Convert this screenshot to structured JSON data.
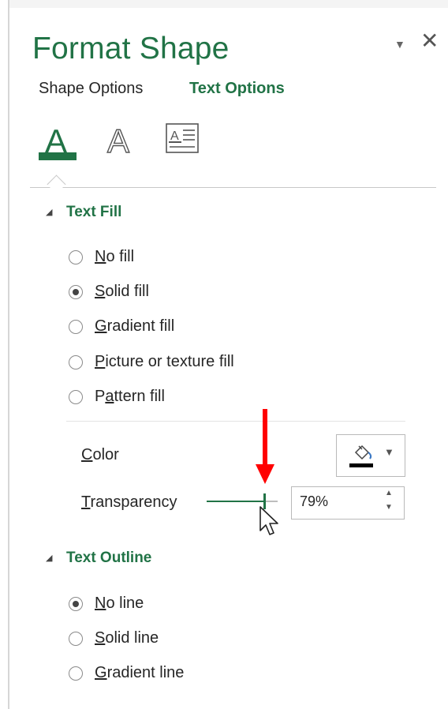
{
  "pane": {
    "title": "Format Shape",
    "options_icon": "triangle-down-icon",
    "close_icon": "close-icon",
    "options_glyph": "▼",
    "close_glyph": "✕"
  },
  "tabs": [
    {
      "label": "Shape Options",
      "active": false
    },
    {
      "label": "Text Options",
      "active": true
    }
  ],
  "category_icons": [
    {
      "name": "text-fill-outline-icon",
      "glyph": "A",
      "selected": true
    },
    {
      "name": "text-effects-icon",
      "glyph": "A",
      "selected": false
    },
    {
      "name": "textbox-icon",
      "selected": false
    }
  ],
  "accent_color": "#217346",
  "text_fill": {
    "heading": "Text Fill",
    "options": [
      {
        "accel": "N",
        "rest": "o fill",
        "selected": false
      },
      {
        "accel": "S",
        "rest": "olid fill",
        "selected": true
      },
      {
        "accel": "G",
        "rest": "radient fill",
        "selected": false
      },
      {
        "accel": "P",
        "rest": "icture or texture fill",
        "selected": false
      },
      {
        "pre": "P",
        "accel": "a",
        "rest": "ttern fill",
        "selected": false
      }
    ],
    "color": {
      "label_accel": "C",
      "label_rest": "olor",
      "icon": "paint-bucket-icon",
      "current_color": "#000000"
    },
    "transparency": {
      "label_accel": "T",
      "label_rest": "ransparency",
      "value": "79%",
      "slider_value": 0.79
    }
  },
  "text_outline": {
    "heading": "Text Outline",
    "options": [
      {
        "accel": "N",
        "rest": "o line",
        "selected": true
      },
      {
        "accel": "S",
        "rest": "olid line",
        "selected": false
      },
      {
        "accel": "G",
        "rest": "radient line",
        "selected": false
      }
    ]
  },
  "annotations": {
    "arrow_color": "#ff0000"
  }
}
